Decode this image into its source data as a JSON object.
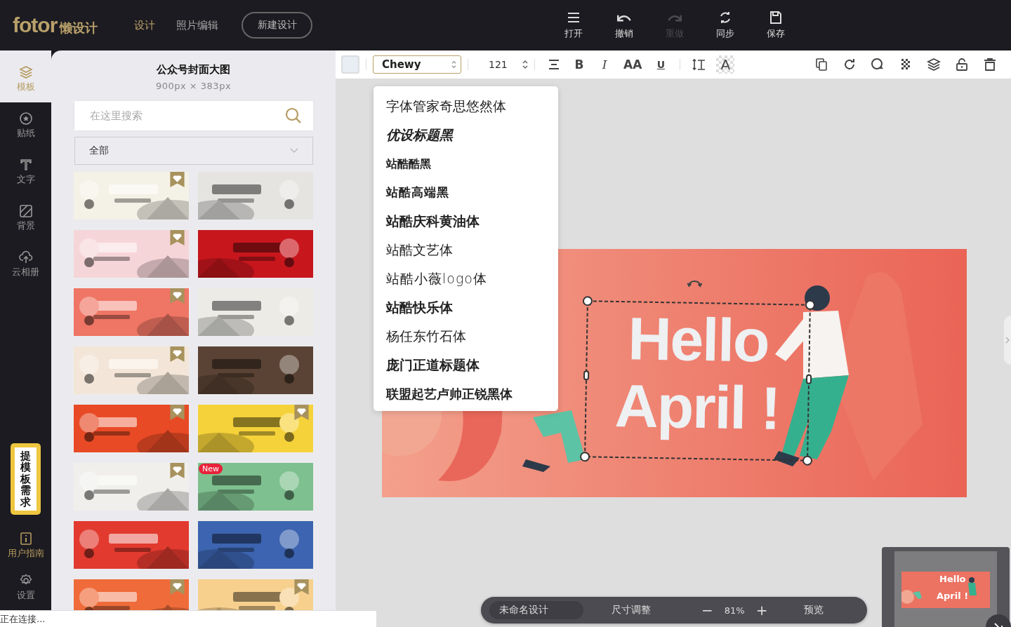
{
  "header": {
    "logo": {
      "brand": "fotor",
      "suffix": "懒设计"
    },
    "nav": [
      {
        "label": "设计",
        "selected": true
      },
      {
        "label": "照片编辑",
        "selected": false
      }
    ],
    "new_button": "新建设计",
    "tools": [
      {
        "kind": "open",
        "label": "打开",
        "disabled": false
      },
      {
        "kind": "undo",
        "label": "撤销",
        "disabled": false
      },
      {
        "kind": "redo",
        "label": "重做",
        "disabled": true
      },
      {
        "kind": "sync",
        "label": "同步",
        "disabled": false
      },
      {
        "kind": "save",
        "label": "保存",
        "disabled": false
      }
    ]
  },
  "rail": {
    "items": [
      {
        "kind": "templates",
        "label": "模板",
        "selected": true
      },
      {
        "kind": "stickers",
        "label": "贴纸",
        "selected": false
      },
      {
        "kind": "text",
        "label": "文字",
        "selected": false
      },
      {
        "kind": "background",
        "label": "背景",
        "selected": false
      },
      {
        "kind": "cloud",
        "label": "云相册",
        "selected": false
      }
    ],
    "request_badge": "提模板需求",
    "bottom_items": [
      {
        "kind": "guide",
        "label": "用户指南"
      },
      {
        "kind": "settings",
        "label": "设置"
      }
    ]
  },
  "panel": {
    "title": "公众号封面大图",
    "size": "900px × 383px",
    "search": {
      "placeholder": "在这里搜索"
    },
    "category": "全部",
    "templates": [
      {
        "kind": "picture",
        "color": "#f4f1e6",
        "premium": true
      },
      {
        "kind": "picture",
        "color": "#e6e4e1",
        "premium": false
      },
      {
        "kind": "picture",
        "color": "#f6d5d8",
        "premium": true
      },
      {
        "kind": "picture",
        "color": "#c8161d",
        "premium": false
      },
      {
        "kind": "picture",
        "color": "#ef7564",
        "premium": true
      },
      {
        "kind": "picture",
        "color": "#ecebe6",
        "premium": false
      },
      {
        "kind": "picture",
        "color": "#f3e6d8",
        "premium": true
      },
      {
        "kind": "picture",
        "color": "#5a4334",
        "premium": false
      },
      {
        "kind": "picture",
        "color": "#e84a25",
        "premium": true
      },
      {
        "kind": "picture",
        "color": "#f5d23a",
        "premium": true
      },
      {
        "kind": "picture",
        "color": "#f0efec",
        "premium": true
      },
      {
        "kind": "picture",
        "color": "#7ec08f",
        "premium": false,
        "badge": "New"
      },
      {
        "kind": "picture",
        "color": "#e23a2f",
        "premium": false
      },
      {
        "kind": "picture",
        "color": "#3c64b0",
        "premium": false
      },
      {
        "kind": "picture",
        "color": "#ef6b3a",
        "premium": true
      },
      {
        "kind": "picture",
        "color": "#f7d08e",
        "premium": true
      }
    ]
  },
  "toolbar": {
    "font": "Chewy",
    "size": "121",
    "text_buttons": [
      "B",
      "I",
      "AA",
      "U"
    ],
    "effect_glyph": "A"
  },
  "font_menu": {
    "items": [
      "字体管家奇思悠然体",
      "优设标题黑",
      "站酷酷黑",
      "站酷高端黑",
      "站酷庆科黄油体",
      "站酷文艺体",
      "站酷小薇logo体",
      "站酷快乐体",
      "杨任东竹石体",
      "庞门正道标题体",
      "联盟起艺卢帅正锐黑体"
    ]
  },
  "canvas": {
    "lines": [
      "Hello",
      "April !"
    ]
  },
  "bottom_bar": {
    "name": "未命名设计",
    "resize": "尺寸调整",
    "zoom_out": "−",
    "zoom": "81%",
    "zoom_in": "+",
    "preview": "预览"
  },
  "minimap": {
    "lines": [
      "Hello",
      "April !"
    ]
  },
  "status": "正在连接..."
}
